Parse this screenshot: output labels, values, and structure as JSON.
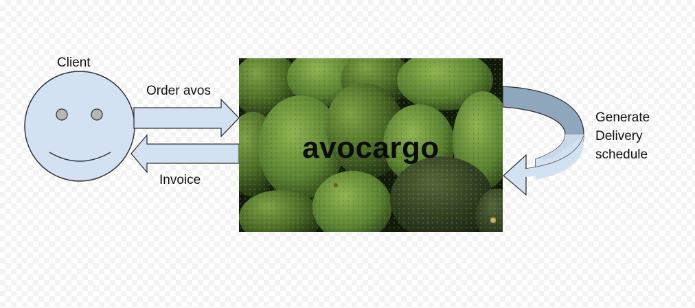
{
  "diagram": {
    "actor_label": "Client",
    "order_label": "Order avos",
    "invoice_label": "Invoice",
    "brand_text": "avocargo",
    "loop_label_line1": "Generate",
    "loop_label_line2": "Delivery",
    "loop_label_line3": "schedule"
  },
  "colors": {
    "arrow_fill": "#d3e2f2",
    "outline": "#333333",
    "avocado_dark": "#27391a",
    "avocado_mid": "#56782e"
  },
  "icons": {
    "client": "smiley-face-icon",
    "avocado_photo": "avocado-photo"
  }
}
